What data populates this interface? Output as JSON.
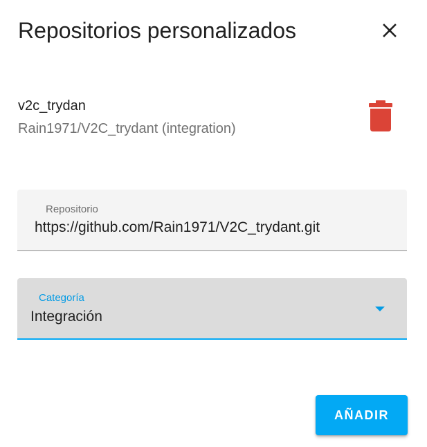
{
  "dialog": {
    "title": "Repositorios personalizados",
    "close_icon": "close-icon"
  },
  "repositories": [
    {
      "name": "v2c_trydan",
      "details": "Rain1971/V2C_trydant (integration)",
      "delete_icon": "trash-icon",
      "delete_color": "#db4437"
    }
  ],
  "form": {
    "repository": {
      "label": "Repositorio",
      "value": "https://github.com/Rain1971/V2C_trydant.git"
    },
    "category": {
      "label": "Categoría",
      "value": "Integración",
      "dropdown_icon": "caret-down-icon"
    },
    "add_button_label": "AÑADIR"
  },
  "colors": {
    "accent": "#03a9f4",
    "danger": "#db4437"
  }
}
